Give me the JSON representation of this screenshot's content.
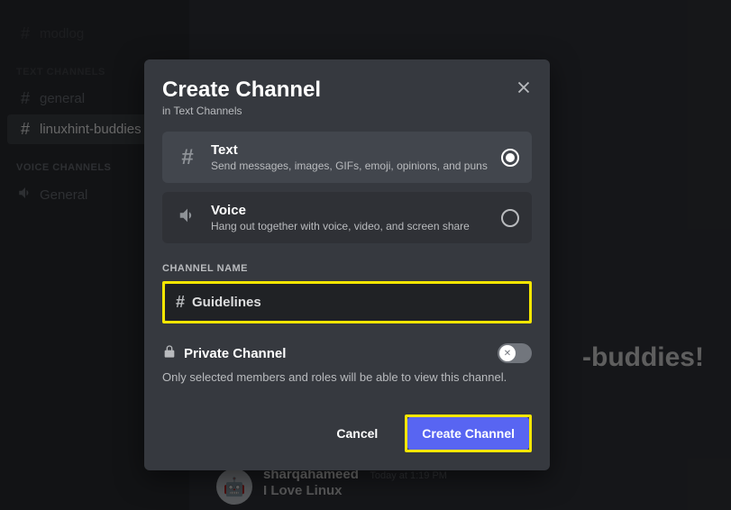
{
  "sidebar": {
    "channels": [
      {
        "name": "modlog",
        "kind": "text",
        "dim": true
      },
      {
        "cat": "TEXT CHANNELS",
        "dim": true
      },
      {
        "name": "general",
        "kind": "text"
      },
      {
        "name": "linuxhint-buddies",
        "kind": "text",
        "active": true
      },
      {
        "cat": "VOICE CHANNELS"
      },
      {
        "name": "General",
        "kind": "voice"
      }
    ]
  },
  "main": {
    "welcome_fragment": "-buddies!",
    "message": {
      "user": "sharqahameed",
      "time": "Today at 1:19 PM",
      "body": "I Love Linux"
    }
  },
  "modal": {
    "title": "Create Channel",
    "subtitle": "in Text Channels",
    "types": {
      "text": {
        "title": "Text",
        "desc": "Send messages, images, GIFs, emoji, opinions, and puns",
        "selected": true
      },
      "voice": {
        "title": "Voice",
        "desc": "Hang out together with voice, video, and screen share",
        "selected": false
      }
    },
    "name_label": "CHANNEL NAME",
    "name_value": "Guidelines",
    "private": {
      "title": "Private Channel",
      "desc": "Only selected members and roles will be able to view this channel.",
      "on": false
    },
    "cancel": "Cancel",
    "create": "Create Channel"
  }
}
